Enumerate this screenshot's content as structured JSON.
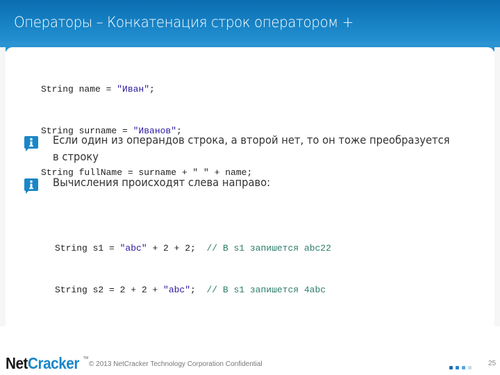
{
  "header": {
    "title": "Операторы – Конкатенация строк оператором +"
  },
  "code_block_1": {
    "lines": [
      {
        "pre": "String name = ",
        "str": "\"Иван\"",
        "post": ";"
      },
      {
        "pre": "String surname = ",
        "str": "\"Иванов\"",
        "post": ";"
      },
      {
        "pre": "String fullName = surname + \" \" + name;",
        "str": "",
        "post": ""
      }
    ]
  },
  "bullets": [
    {
      "icon": "info-icon",
      "text_line1": "Если один из операндов строка, а второй нет, то он тоже преобразуется",
      "text_line2": "в строку"
    },
    {
      "icon": "info-icon",
      "text_line1": "Вычисления происходят слева направо:",
      "text_line2": ""
    }
  ],
  "code_block_2": {
    "lines": [
      {
        "pre": "String s1 = ",
        "str": "\"abc\"",
        "post": " + 2 + 2;  ",
        "comment": "// В s1 запишется abc22"
      },
      {
        "pre": "String s2 = 2 + 2 + ",
        "str": "\"abc\"",
        "post": ";  ",
        "comment": "// В s1 запишется 4abc"
      }
    ]
  },
  "footer": {
    "logo_part1": "Net",
    "logo_part2": "Cracker",
    "trademark": "TM",
    "copyright": "© 2013 NetCracker Technology Corporation Confidential",
    "page_number": "25",
    "progress_dots": [
      "#1a6fa8",
      "#2a86c8",
      "#5aa5d8",
      "#c8dbe8"
    ]
  },
  "colors": {
    "accent": "#1a86c8",
    "header_dark": "#0a6db0"
  }
}
